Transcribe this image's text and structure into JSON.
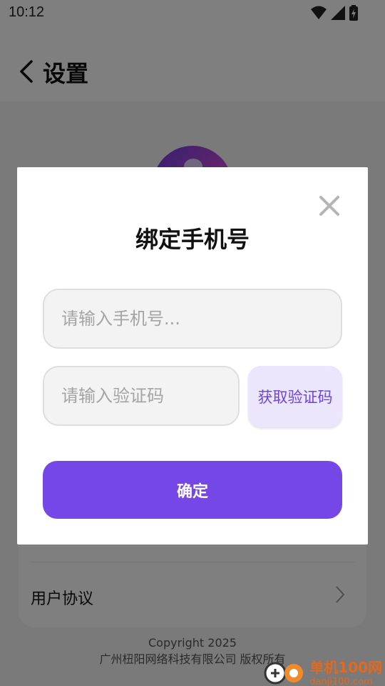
{
  "status_bar": {
    "time": "10:12",
    "icons": [
      "wifi-icon",
      "signal-icon",
      "battery-icon"
    ]
  },
  "header": {
    "title": "设置"
  },
  "settings": {
    "row_label": "用户协议"
  },
  "footer": {
    "copyright_line1": "Copyright 2025",
    "copyright_line2": "广州杻阳网络科技有限公司 版权所有"
  },
  "watermark": {
    "brand": "单机100网",
    "domain": "danji100.com"
  },
  "dialog": {
    "title": "绑定手机号",
    "phone_placeholder": "请输入手机号...",
    "phone_value": "",
    "code_placeholder": "请输入验证码",
    "code_value": "",
    "get_code_label": "获取验证码",
    "confirm_label": "确定"
  },
  "colors": {
    "accent": "#7447e6",
    "get_code_bg": "#ece6fd",
    "get_code_text": "#6c45d8",
    "overlay": "rgba(0,0,0,0.5)"
  }
}
